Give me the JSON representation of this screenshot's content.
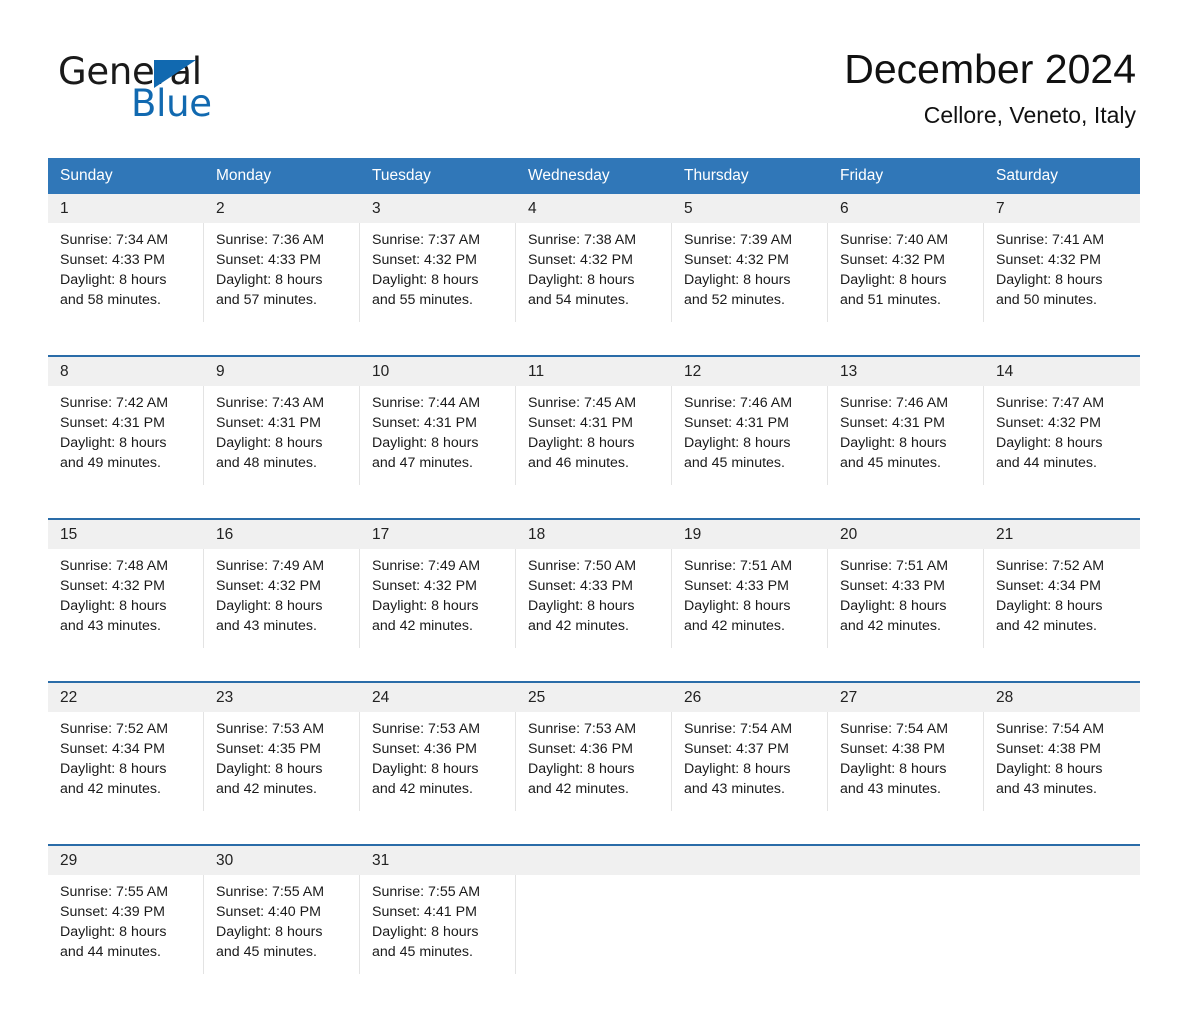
{
  "logo": {
    "word_one": "General",
    "word_two": "Blue",
    "triangle_color": "#1169b0",
    "blue_text_color": "#1169b0"
  },
  "header": {
    "title": "December 2024",
    "location": "Cellore, Veneto, Italy"
  },
  "theme": {
    "header_blue": "#3077b8",
    "week_divider_blue": "#2a6ca8",
    "daynum_band_gray": "#f0f0f0",
    "column_divider": "#e3e3e3",
    "page_background": "#ffffff",
    "text": "#1a1a1a"
  },
  "calendar": {
    "weekday_headers": [
      "Sunday",
      "Monday",
      "Tuesday",
      "Wednesday",
      "Thursday",
      "Friday",
      "Saturday"
    ],
    "weeks": [
      [
        {
          "day": "1",
          "sunrise": "Sunrise: 7:34 AM",
          "sunset": "Sunset: 4:33 PM",
          "daylight_line1": "Daylight: 8 hours",
          "daylight_line2": "and 58 minutes."
        },
        {
          "day": "2",
          "sunrise": "Sunrise: 7:36 AM",
          "sunset": "Sunset: 4:33 PM",
          "daylight_line1": "Daylight: 8 hours",
          "daylight_line2": "and 57 minutes."
        },
        {
          "day": "3",
          "sunrise": "Sunrise: 7:37 AM",
          "sunset": "Sunset: 4:32 PM",
          "daylight_line1": "Daylight: 8 hours",
          "daylight_line2": "and 55 minutes."
        },
        {
          "day": "4",
          "sunrise": "Sunrise: 7:38 AM",
          "sunset": "Sunset: 4:32 PM",
          "daylight_line1": "Daylight: 8 hours",
          "daylight_line2": "and 54 minutes."
        },
        {
          "day": "5",
          "sunrise": "Sunrise: 7:39 AM",
          "sunset": "Sunset: 4:32 PM",
          "daylight_line1": "Daylight: 8 hours",
          "daylight_line2": "and 52 minutes."
        },
        {
          "day": "6",
          "sunrise": "Sunrise: 7:40 AM",
          "sunset": "Sunset: 4:32 PM",
          "daylight_line1": "Daylight: 8 hours",
          "daylight_line2": "and 51 minutes."
        },
        {
          "day": "7",
          "sunrise": "Sunrise: 7:41 AM",
          "sunset": "Sunset: 4:32 PM",
          "daylight_line1": "Daylight: 8 hours",
          "daylight_line2": "and 50 minutes."
        }
      ],
      [
        {
          "day": "8",
          "sunrise": "Sunrise: 7:42 AM",
          "sunset": "Sunset: 4:31 PM",
          "daylight_line1": "Daylight: 8 hours",
          "daylight_line2": "and 49 minutes."
        },
        {
          "day": "9",
          "sunrise": "Sunrise: 7:43 AM",
          "sunset": "Sunset: 4:31 PM",
          "daylight_line1": "Daylight: 8 hours",
          "daylight_line2": "and 48 minutes."
        },
        {
          "day": "10",
          "sunrise": "Sunrise: 7:44 AM",
          "sunset": "Sunset: 4:31 PM",
          "daylight_line1": "Daylight: 8 hours",
          "daylight_line2": "and 47 minutes."
        },
        {
          "day": "11",
          "sunrise": "Sunrise: 7:45 AM",
          "sunset": "Sunset: 4:31 PM",
          "daylight_line1": "Daylight: 8 hours",
          "daylight_line2": "and 46 minutes."
        },
        {
          "day": "12",
          "sunrise": "Sunrise: 7:46 AM",
          "sunset": "Sunset: 4:31 PM",
          "daylight_line1": "Daylight: 8 hours",
          "daylight_line2": "and 45 minutes."
        },
        {
          "day": "13",
          "sunrise": "Sunrise: 7:46 AM",
          "sunset": "Sunset: 4:31 PM",
          "daylight_line1": "Daylight: 8 hours",
          "daylight_line2": "and 45 minutes."
        },
        {
          "day": "14",
          "sunrise": "Sunrise: 7:47 AM",
          "sunset": "Sunset: 4:32 PM",
          "daylight_line1": "Daylight: 8 hours",
          "daylight_line2": "and 44 minutes."
        }
      ],
      [
        {
          "day": "15",
          "sunrise": "Sunrise: 7:48 AM",
          "sunset": "Sunset: 4:32 PM",
          "daylight_line1": "Daylight: 8 hours",
          "daylight_line2": "and 43 minutes."
        },
        {
          "day": "16",
          "sunrise": "Sunrise: 7:49 AM",
          "sunset": "Sunset: 4:32 PM",
          "daylight_line1": "Daylight: 8 hours",
          "daylight_line2": "and 43 minutes."
        },
        {
          "day": "17",
          "sunrise": "Sunrise: 7:49 AM",
          "sunset": "Sunset: 4:32 PM",
          "daylight_line1": "Daylight: 8 hours",
          "daylight_line2": "and 42 minutes."
        },
        {
          "day": "18",
          "sunrise": "Sunrise: 7:50 AM",
          "sunset": "Sunset: 4:33 PM",
          "daylight_line1": "Daylight: 8 hours",
          "daylight_line2": "and 42 minutes."
        },
        {
          "day": "19",
          "sunrise": "Sunrise: 7:51 AM",
          "sunset": "Sunset: 4:33 PM",
          "daylight_line1": "Daylight: 8 hours",
          "daylight_line2": "and 42 minutes."
        },
        {
          "day": "20",
          "sunrise": "Sunrise: 7:51 AM",
          "sunset": "Sunset: 4:33 PM",
          "daylight_line1": "Daylight: 8 hours",
          "daylight_line2": "and 42 minutes."
        },
        {
          "day": "21",
          "sunrise": "Sunrise: 7:52 AM",
          "sunset": "Sunset: 4:34 PM",
          "daylight_line1": "Daylight: 8 hours",
          "daylight_line2": "and 42 minutes."
        }
      ],
      [
        {
          "day": "22",
          "sunrise": "Sunrise: 7:52 AM",
          "sunset": "Sunset: 4:34 PM",
          "daylight_line1": "Daylight: 8 hours",
          "daylight_line2": "and 42 minutes."
        },
        {
          "day": "23",
          "sunrise": "Sunrise: 7:53 AM",
          "sunset": "Sunset: 4:35 PM",
          "daylight_line1": "Daylight: 8 hours",
          "daylight_line2": "and 42 minutes."
        },
        {
          "day": "24",
          "sunrise": "Sunrise: 7:53 AM",
          "sunset": "Sunset: 4:36 PM",
          "daylight_line1": "Daylight: 8 hours",
          "daylight_line2": "and 42 minutes."
        },
        {
          "day": "25",
          "sunrise": "Sunrise: 7:53 AM",
          "sunset": "Sunset: 4:36 PM",
          "daylight_line1": "Daylight: 8 hours",
          "daylight_line2": "and 42 minutes."
        },
        {
          "day": "26",
          "sunrise": "Sunrise: 7:54 AM",
          "sunset": "Sunset: 4:37 PM",
          "daylight_line1": "Daylight: 8 hours",
          "daylight_line2": "and 43 minutes."
        },
        {
          "day": "27",
          "sunrise": "Sunrise: 7:54 AM",
          "sunset": "Sunset: 4:38 PM",
          "daylight_line1": "Daylight: 8 hours",
          "daylight_line2": "and 43 minutes."
        },
        {
          "day": "28",
          "sunrise": "Sunrise: 7:54 AM",
          "sunset": "Sunset: 4:38 PM",
          "daylight_line1": "Daylight: 8 hours",
          "daylight_line2": "and 43 minutes."
        }
      ],
      [
        {
          "day": "29",
          "sunrise": "Sunrise: 7:55 AM",
          "sunset": "Sunset: 4:39 PM",
          "daylight_line1": "Daylight: 8 hours",
          "daylight_line2": "and 44 minutes."
        },
        {
          "day": "30",
          "sunrise": "Sunrise: 7:55 AM",
          "sunset": "Sunset: 4:40 PM",
          "daylight_line1": "Daylight: 8 hours",
          "daylight_line2": "and 45 minutes."
        },
        {
          "day": "31",
          "sunrise": "Sunrise: 7:55 AM",
          "sunset": "Sunset: 4:41 PM",
          "daylight_line1": "Daylight: 8 hours",
          "daylight_line2": "and 45 minutes."
        },
        {
          "day": "",
          "sunrise": "",
          "sunset": "",
          "daylight_line1": "",
          "daylight_line2": ""
        },
        {
          "day": "",
          "sunrise": "",
          "sunset": "",
          "daylight_line1": "",
          "daylight_line2": ""
        },
        {
          "day": "",
          "sunrise": "",
          "sunset": "",
          "daylight_line1": "",
          "daylight_line2": ""
        },
        {
          "day": "",
          "sunrise": "",
          "sunset": "",
          "daylight_line1": "",
          "daylight_line2": ""
        }
      ]
    ]
  }
}
